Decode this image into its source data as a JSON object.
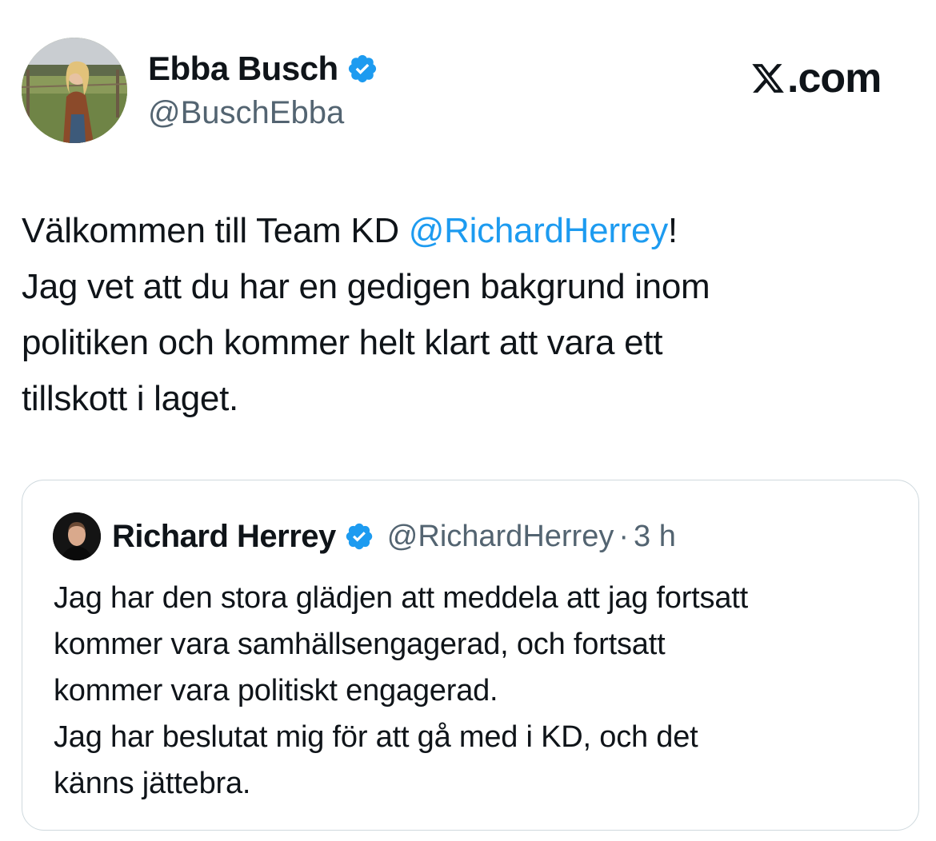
{
  "brand": {
    "suffix": ".com",
    "accent": "#1d9bf0",
    "icon": "x-logo-icon"
  },
  "author": {
    "name": "Ebba Busch",
    "handle": "@BuschEbba",
    "verified": true,
    "avatar_icon": "profile-photo-avatar"
  },
  "tweet": {
    "lines": [
      {
        "pre": "Välkommen till Team KD ",
        "mention": "@RichardHerrey",
        "post": "!"
      },
      {
        "pre": "Jag vet att du har en gedigen bakgrund inom"
      },
      {
        "pre": "politiken och kommer helt klart att vara ett"
      },
      {
        "pre": "tillskott i laget."
      }
    ]
  },
  "quoted": {
    "name": "Richard Herrey",
    "handle": "@RichardHerrey",
    "separator": "·",
    "time": "3 h",
    "verified": true,
    "lines": [
      "Jag har den stora glädjen att meddela att jag fortsatt",
      "kommer vara samhällsengagerad, och fortsatt",
      "kommer vara politiskt engagerad.",
      "Jag har beslutat mig för att gå med i KD, och det",
      "känns jättebra."
    ]
  }
}
